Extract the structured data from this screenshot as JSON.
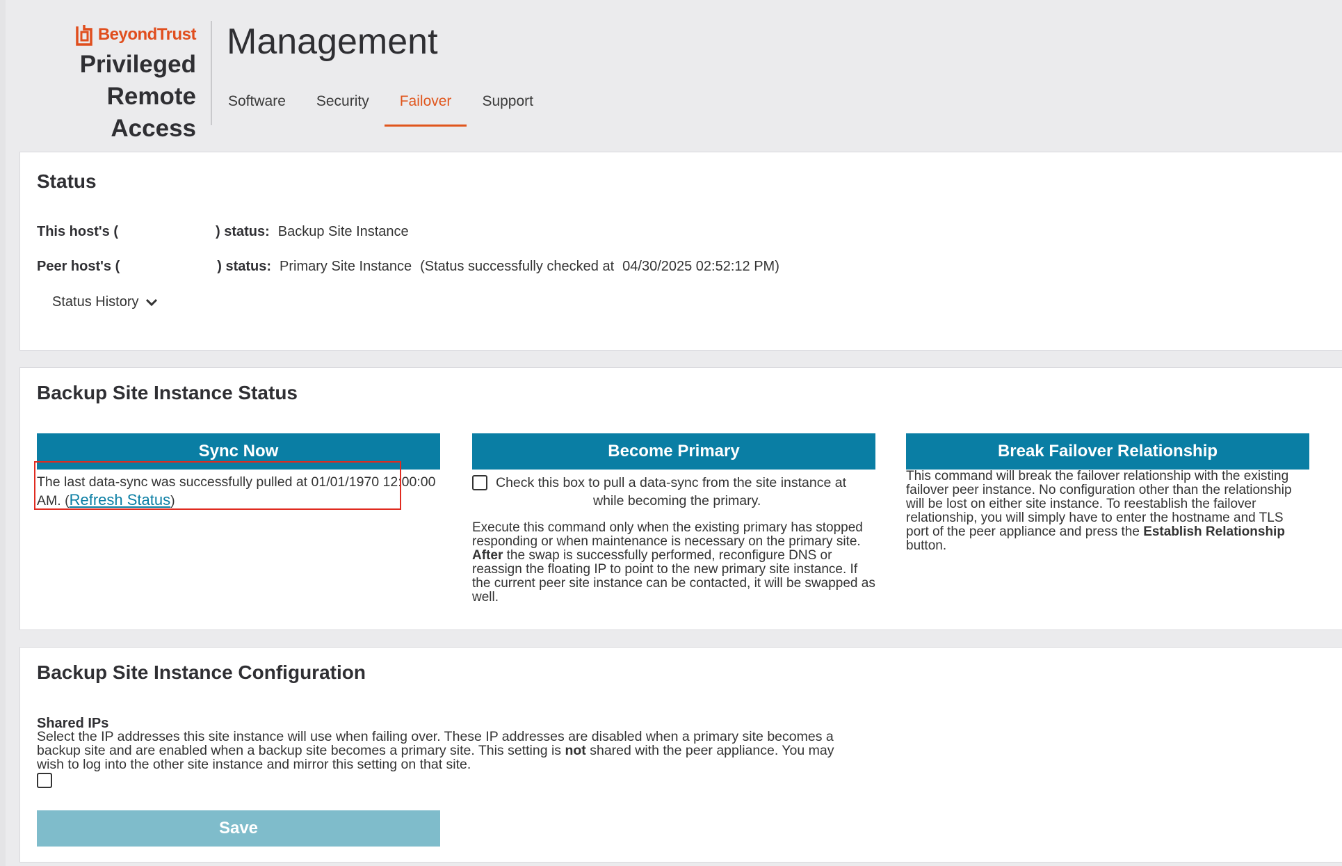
{
  "header": {
    "logo_text": "BeyondTrust",
    "product_line1": "Privileged",
    "product_line2": "Remote Access",
    "page_title": "Management"
  },
  "tabs": [
    {
      "label": "Software",
      "active": false
    },
    {
      "label": "Security",
      "active": false
    },
    {
      "label": "Failover",
      "active": true
    },
    {
      "label": "Support",
      "active": false
    }
  ],
  "status": {
    "title": "Status",
    "this_host_label_start": "This host's (",
    "this_host_label_end": ") status:",
    "this_host_value": "Backup Site Instance",
    "peer_host_label_start": "Peer host's (",
    "peer_host_label_end": ") status:",
    "peer_host_value": "Primary Site Instance",
    "peer_checked_text": "(Status successfully checked at",
    "peer_checked_time": "04/30/2025 02:52:12 PM)",
    "history_label": "Status History"
  },
  "backup_status": {
    "title": "Backup Site Instance Status",
    "sync_now": {
      "button_label": "Sync Now",
      "text": "The last data-sync was successfully pulled at 01/01/1970 12:00:00 AM. (",
      "refresh_link": "Refresh Status",
      "text_end": ")"
    },
    "become_primary": {
      "button_label": "Become Primary",
      "checkbox_label_1": "Check this box to pull a data-sync from the site instance at",
      "checkbox_label_2": "while becoming the primary.",
      "desc_1": "Execute this command only when the existing primary has stopped responding or when maintenance is necessary on the primary site.",
      "desc_2_bold": "After",
      "desc_2": "the swap is successfully performed, reconfigure DNS or reassign the floating IP to point to the new primary site instance. If the current peer site instance can be contacted, it will be swapped as well."
    },
    "break_failover": {
      "button_label": "Break Failover Relationship",
      "desc": "This command will break the failover relationship with the existing failover peer instance. No configuration other than the relationship will be lost on either site instance. To reestablish the failover relationship, you will simply have to enter the hostname and TLS port of the peer appliance and press the",
      "desc_bold": "Establish Relationship",
      "desc_end": "button."
    }
  },
  "config": {
    "title": "Backup Site Instance Configuration",
    "shared_ips_title": "Shared IPs",
    "shared_ips_desc_1": "Select the IP addresses this site instance will use when failing over. These IP addresses are disabled when a primary site becomes a backup site and are enabled when a backup site becomes a primary site. This setting is",
    "shared_ips_desc_bold": "not",
    "shared_ips_desc_2": "shared with the peer appliance. You may wish to log into the other site instance and mirror this setting on that site.",
    "save_label": "Save"
  },
  "colors": {
    "accent": "#e0561d",
    "button_blue": "#0a7ea4",
    "save_disabled": "#7fbccb",
    "highlight_red": "#e02b20"
  }
}
